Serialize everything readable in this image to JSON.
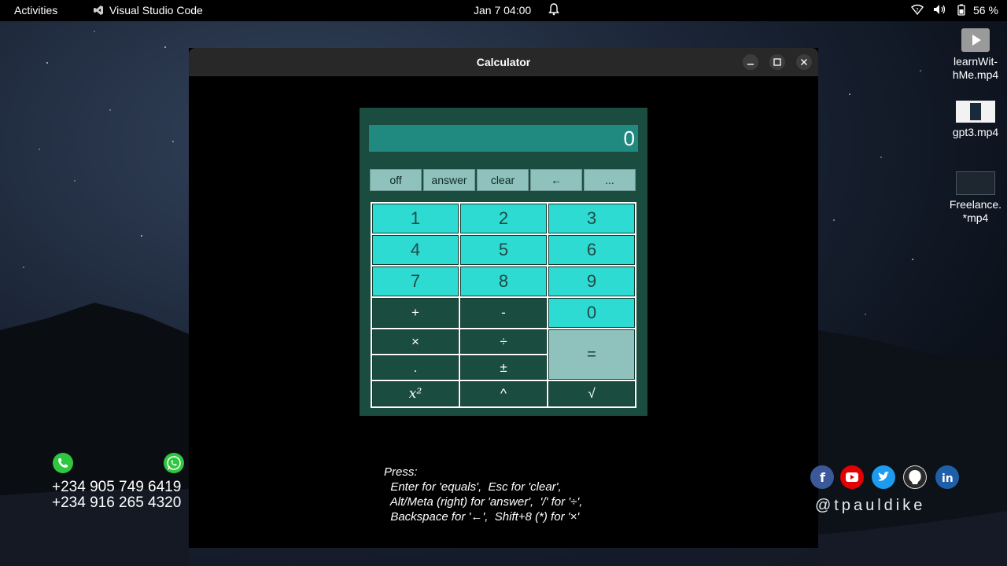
{
  "topbar": {
    "activities": "Activities",
    "app_name": "Visual Studio Code",
    "clock": "Jan 7  04:00",
    "battery_pct": "56 %"
  },
  "desktop": {
    "files": [
      {
        "name": "learnWit-\nhMe.mp4",
        "icon": "video-play-thumbnail"
      },
      {
        "name": "gpt3.mp4",
        "icon": "video-thumbnail"
      },
      {
        "name": "Freelance.\n*mp4",
        "icon": "video-thumbnail"
      }
    ]
  },
  "window": {
    "title": "Calculator",
    "controls": [
      "minimize",
      "maximize",
      "close"
    ]
  },
  "calculator": {
    "display": "0",
    "function_buttons": [
      "off",
      "answer",
      "clear",
      "←",
      "..."
    ],
    "keys": {
      "k1": "1",
      "k2": "2",
      "k3": "3",
      "k4": "4",
      "k5": "5",
      "k6": "6",
      "k7": "7",
      "k8": "8",
      "k9": "9",
      "plus": "+",
      "minus": "-",
      "k0": "0",
      "times": "×",
      "divide": "÷",
      "equals": "=",
      "dot": ".",
      "plusminus": "±",
      "square": "x²",
      "power": "^",
      "sqrt": "√"
    }
  },
  "instructions": {
    "line1": "Press:",
    "line2": "  Enter for 'equals',  Esc for 'clear',",
    "line3": "  Alt/Meta (right) for 'answer',  '/' for '÷',",
    "line4": "  Backspace for '←',  Shift+8 (*) for '×'"
  },
  "contacts": {
    "phone1": "+234 905 749 6419",
    "phone2": "+234 916 265 4320",
    "handle": "@tpauldike",
    "socials": [
      "facebook",
      "youtube",
      "twitter",
      "github",
      "linkedin"
    ]
  },
  "colors": {
    "calc_bg": "#1a4d3f",
    "display_bg": "#218a80",
    "number_key": "#2edbd3",
    "function_key": "#8fc1bd"
  }
}
